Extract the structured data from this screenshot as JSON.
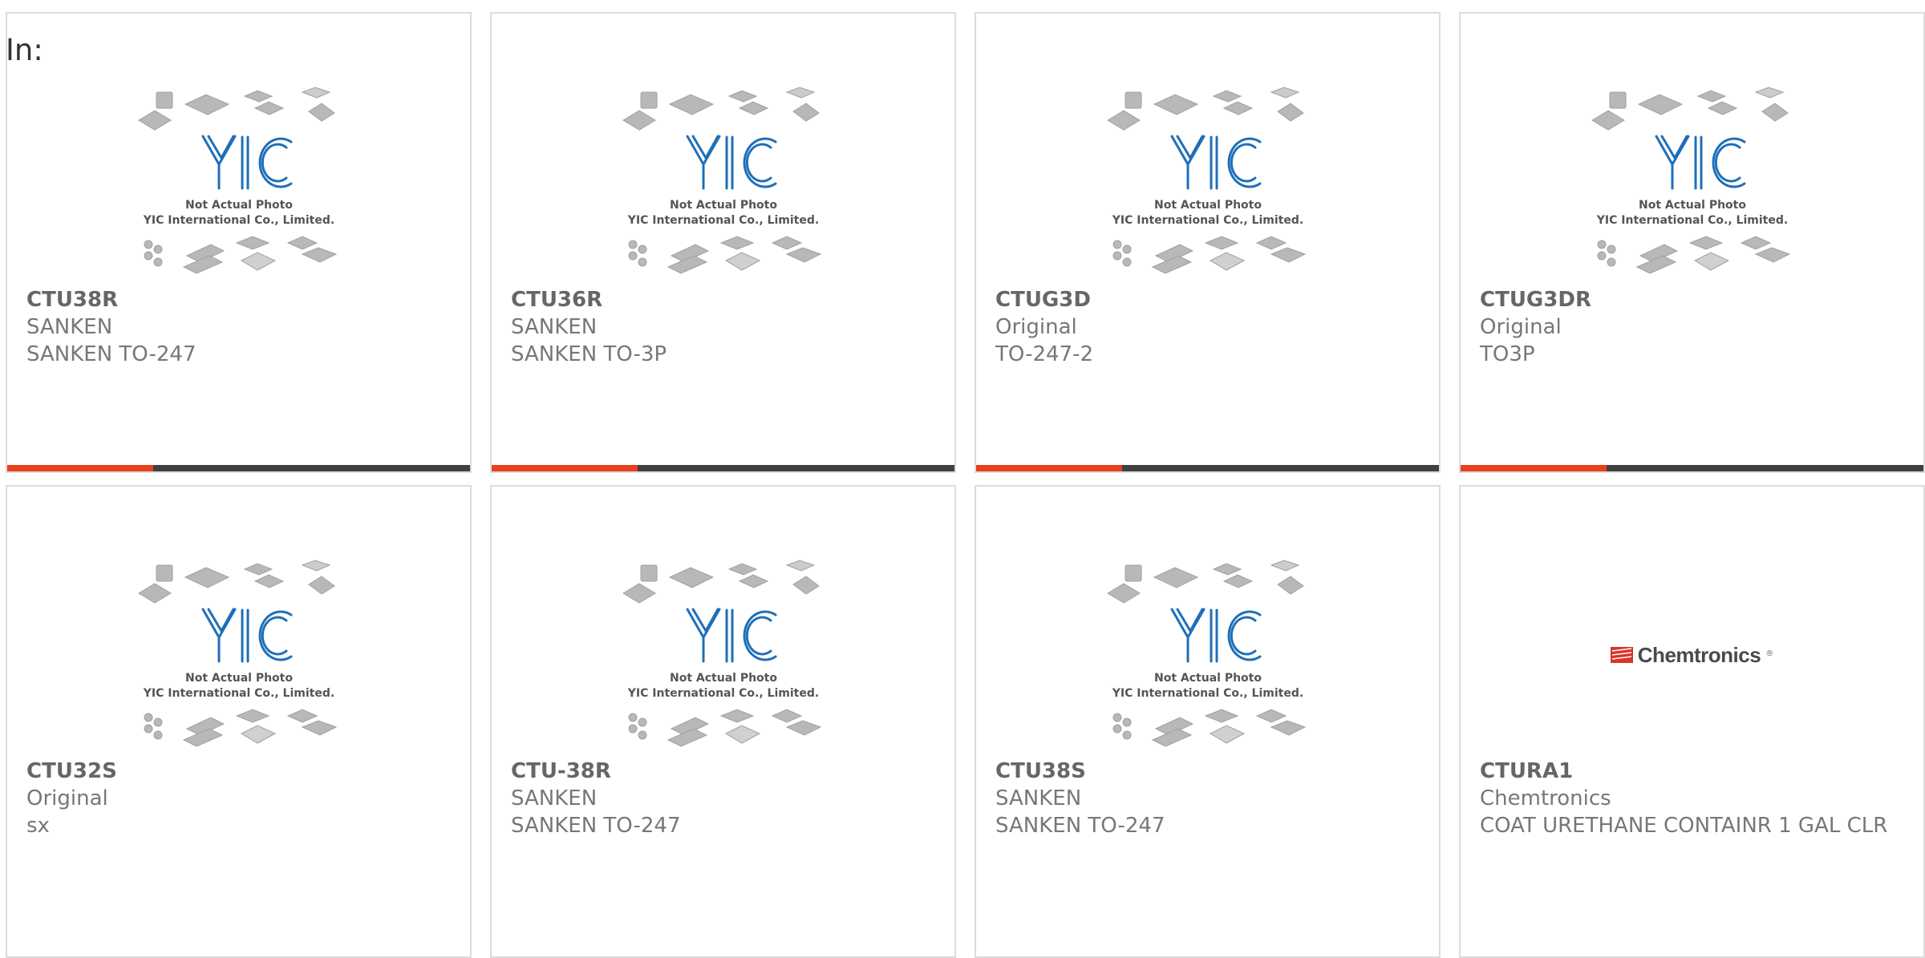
{
  "filter_label": "In:",
  "placeholder": {
    "line1": "Not Actual Photo",
    "line2": "YIC International Co., Limited."
  },
  "brand_logo": {
    "text": "Chemtronics",
    "mark": "®"
  },
  "colors": {
    "accent": "#e8401c",
    "bar": "#404040",
    "yic_blue": "#1e6fb8",
    "border": "#dcdcdc"
  },
  "products": [
    {
      "part_number": "CTU38R",
      "manufacturer": "SANKEN",
      "description": "SANKEN TO-247",
      "image": "yic-placeholder"
    },
    {
      "part_number": "CTU36R",
      "manufacturer": "SANKEN",
      "description": "SANKEN TO-3P",
      "image": "yic-placeholder"
    },
    {
      "part_number": "CTUG3D",
      "manufacturer": "Original",
      "description": "TO-247-2",
      "image": "yic-placeholder"
    },
    {
      "part_number": "CTUG3DR",
      "manufacturer": "Original",
      "description": "TO3P",
      "image": "yic-placeholder"
    },
    {
      "part_number": "CTU32S",
      "manufacturer": "Original",
      "description": "sx",
      "image": "yic-placeholder"
    },
    {
      "part_number": "CTU-38R",
      "manufacturer": "SANKEN",
      "description": "SANKEN TO-247",
      "image": "yic-placeholder"
    },
    {
      "part_number": "CTU38S",
      "manufacturer": "SANKEN",
      "description": "SANKEN TO-247",
      "image": "yic-placeholder"
    },
    {
      "part_number": "CTURA1",
      "manufacturer": "Chemtronics",
      "description": "COAT URETHANE CONTAINR 1 GAL CLR",
      "image": "chemtronics-logo"
    }
  ]
}
